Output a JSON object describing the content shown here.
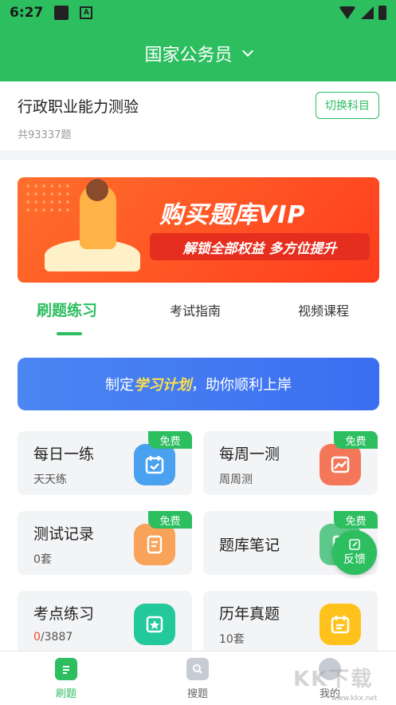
{
  "status_bar": {
    "time": "6:27"
  },
  "header": {
    "title": "国家公务员"
  },
  "subject": {
    "name": "行政职业能力测验",
    "count": "共93337题",
    "switch_label": "切换科目"
  },
  "banner": {
    "title": "购买题库VIP",
    "subtitle": "解锁全部权益  多方位提升"
  },
  "tabs": [
    {
      "label": "刷题练习",
      "active": true
    },
    {
      "label": "考试指南",
      "active": false
    },
    {
      "label": "视频课程",
      "active": false
    }
  ],
  "plan": {
    "prefix": "制定",
    "highlight": "学习计划",
    "suffix": "，助你顺利上岸"
  },
  "tiles": [
    {
      "title": "每日一练",
      "sub": "天天练",
      "badge": "免费",
      "icon": "calendar-icon",
      "color": "#4aa1f0"
    },
    {
      "title": "每周一测",
      "sub": "周周测",
      "badge": "免费",
      "icon": "chart-icon",
      "color": "#f4775a"
    },
    {
      "title": "测试记录",
      "sub": "0套",
      "badge": "免费",
      "icon": "document-icon",
      "color": "#f8a25a"
    },
    {
      "title": "题库笔记",
      "sub": "",
      "badge": "免费",
      "icon": "note-icon",
      "color": "#5cc98a"
    },
    {
      "title": "考点练习",
      "sub_highlight": "0",
      "sub_rest": "/3887",
      "icon": "star-card-icon",
      "color": "#23c99a"
    },
    {
      "title": "历年真题",
      "sub": "10套",
      "icon": "exam-calendar-icon",
      "color": "#ffc21c"
    }
  ],
  "feedback": {
    "label": "反馈"
  },
  "bottom_nav": [
    {
      "label": "刷题",
      "icon": "practice-icon",
      "active": true
    },
    {
      "label": "搜题",
      "icon": "search-icon",
      "active": false
    },
    {
      "label": "我的",
      "icon": "profile-icon",
      "active": false
    }
  ],
  "watermark": {
    "text": "KK下载",
    "url": "www.kkx.net"
  }
}
